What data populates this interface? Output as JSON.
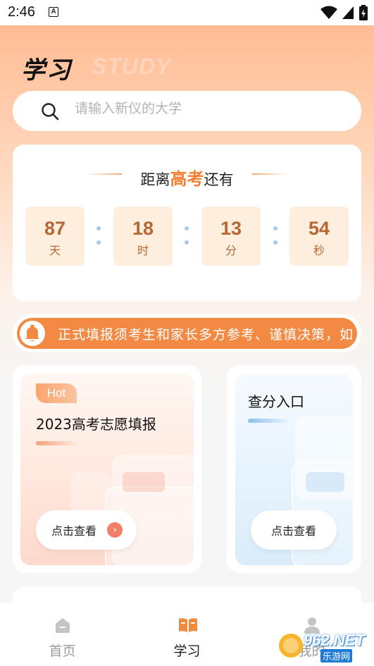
{
  "status_bar": {
    "time": "2:46",
    "notification_icon": "a-letter-icon",
    "icons": [
      "wifi-icon",
      "signal-icon",
      "battery-icon"
    ]
  },
  "header": {
    "title": "学习",
    "title_en": "STUDY"
  },
  "search": {
    "placeholder": "请输入新仪的大学",
    "value": ""
  },
  "countdown": {
    "title_prefix": "距离",
    "title_highlight": "高考",
    "title_suffix": "还有",
    "units": [
      {
        "value": "87",
        "label": "天"
      },
      {
        "value": "18",
        "label": "时"
      },
      {
        "value": "13",
        "label": "分"
      },
      {
        "value": "54",
        "label": "秒"
      }
    ]
  },
  "notice": {
    "icon": "bell-icon",
    "text": "正式填报须考生和家长多方参考、谨慎决策，如"
  },
  "cards": {
    "left": {
      "badge": "Hot",
      "title": "2023高考志愿填报",
      "button": "点击查看"
    },
    "right": {
      "title": "查分入口",
      "button": "点击查看"
    }
  },
  "bottom_nav": {
    "items": [
      {
        "label": "首页",
        "icon": "home-icon",
        "active": false
      },
      {
        "label": "学习",
        "icon": "book-icon",
        "active": true
      },
      {
        "label": "我的",
        "icon": "profile-icon",
        "active": false
      }
    ]
  },
  "watermark": {
    "text": "962.NET",
    "sub": "乐游网"
  },
  "colors": {
    "accent": "#f47e31",
    "active_nav": "#f08a3e",
    "inactive_nav": "#9a9a9a",
    "countdown_box": "#fdeede",
    "countdown_text": "#b66734"
  }
}
